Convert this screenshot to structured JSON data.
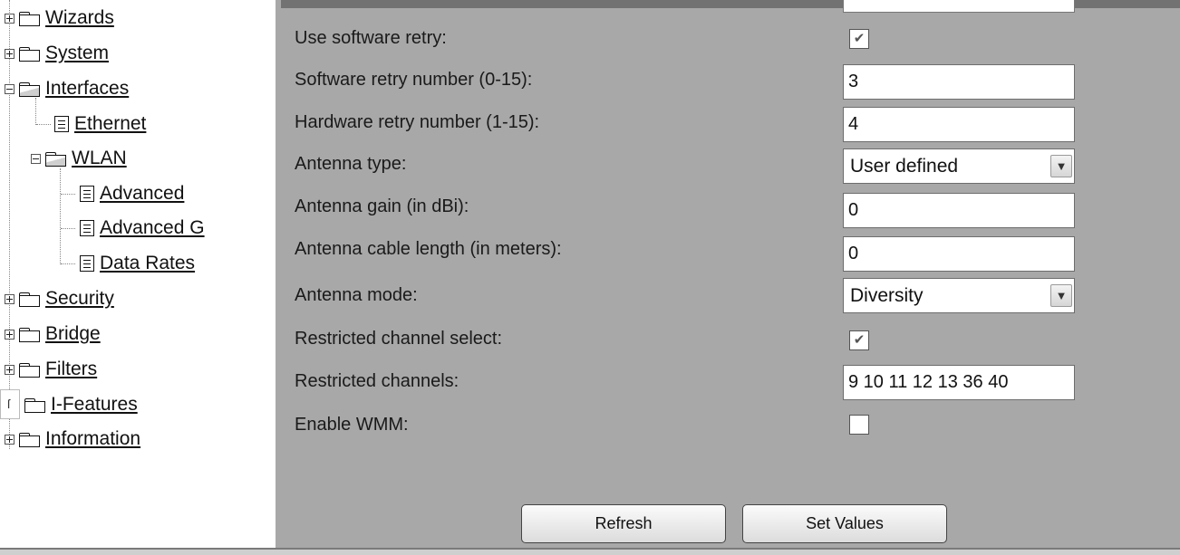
{
  "sidebar": {
    "items": [
      {
        "label": "Wizards"
      },
      {
        "label": "System"
      },
      {
        "label": "Interfaces"
      },
      {
        "label": "Ethernet"
      },
      {
        "label": "WLAN"
      },
      {
        "label": "Advanced"
      },
      {
        "label": "Advanced G"
      },
      {
        "label": "Data Rates"
      },
      {
        "label": "Security"
      },
      {
        "label": "Bridge"
      },
      {
        "label": "Filters"
      },
      {
        "label": "I-Features"
      },
      {
        "label": "Information"
      }
    ],
    "ifeatures_box_text": "ſ"
  },
  "form": {
    "use_software_retry": {
      "label": "Use software retry:",
      "checked": true
    },
    "software_retry_number": {
      "label": "Software retry number (0-15):",
      "value": "3"
    },
    "hardware_retry_number": {
      "label": "Hardware retry number (1-15):",
      "value": "4"
    },
    "antenna_type": {
      "label": "Antenna type:",
      "value": "User defined"
    },
    "antenna_gain": {
      "label": "Antenna gain (in dBi):",
      "value": "0"
    },
    "antenna_cable_length": {
      "label": "Antenna cable length (in meters):",
      "value": "0"
    },
    "antenna_mode": {
      "label": "Antenna mode:",
      "value": "Diversity"
    },
    "restricted_channel_select": {
      "label": "Restricted channel select:",
      "checked": true
    },
    "restricted_channels": {
      "label": "Restricted channels:",
      "value": "9 10 11 12 13 36 40"
    },
    "enable_wmm": {
      "label": "Enable WMM:",
      "checked": false
    }
  },
  "buttons": {
    "refresh": "Refresh",
    "set_values": "Set Values"
  },
  "glyphs": {
    "check": "✔",
    "chevron": "▼"
  }
}
